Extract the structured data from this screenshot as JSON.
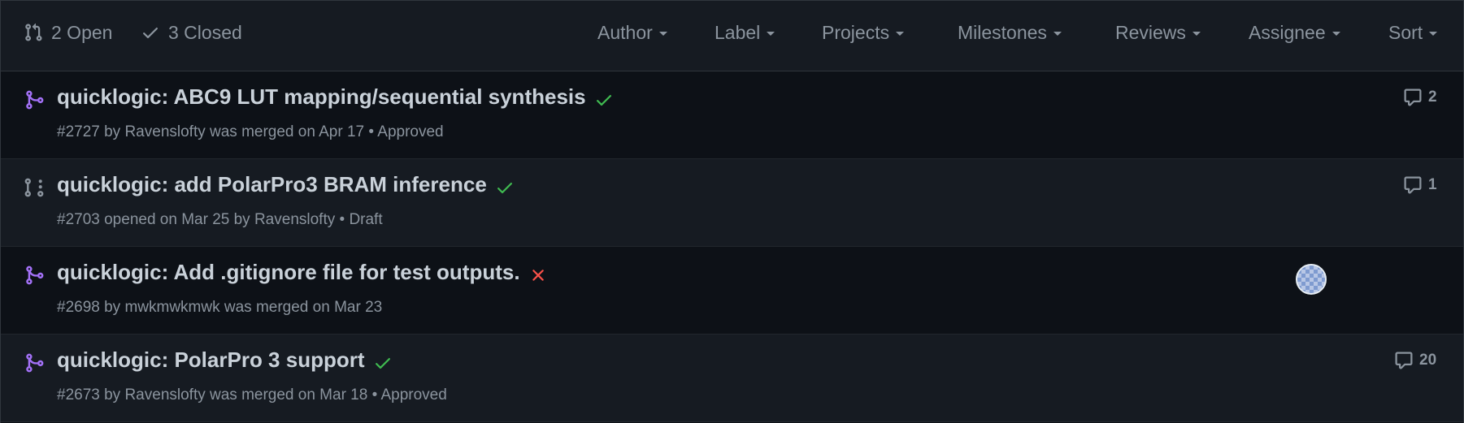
{
  "header": {
    "open_label": "2 Open",
    "closed_label": "3 Closed",
    "filters": [
      "Author",
      "Label",
      "Projects",
      "Milestones",
      "Reviews",
      "Assignee",
      "Sort"
    ]
  },
  "rows": [
    {
      "title": "quicklogic: ABC9 LUT mapping/sequential synthesis",
      "meta": "#2727 by Ravenslofty was merged on Apr 17 • Approved",
      "status": "check",
      "comments": "2"
    },
    {
      "title": "quicklogic: add PolarPro3 BRAM inference",
      "meta": "#2703 opened on Mar 25 by Ravenslofty • Draft",
      "status": "check",
      "comments": "1"
    },
    {
      "title": "quicklogic: Add .gitignore file for test outputs.",
      "meta": "#2698 by mwkmwkmwk was merged on Mar 23",
      "status": "x",
      "comments": ""
    },
    {
      "title": "quicklogic: PolarPro 3 support",
      "meta": "#2673 by Ravenslofty was merged on Mar 18 • Approved",
      "status": "check",
      "comments": "20"
    }
  ],
  "colors": {
    "merged": "#a371f7",
    "draft": "#8b949e",
    "success": "#3fb950",
    "failure": "#f85149"
  }
}
